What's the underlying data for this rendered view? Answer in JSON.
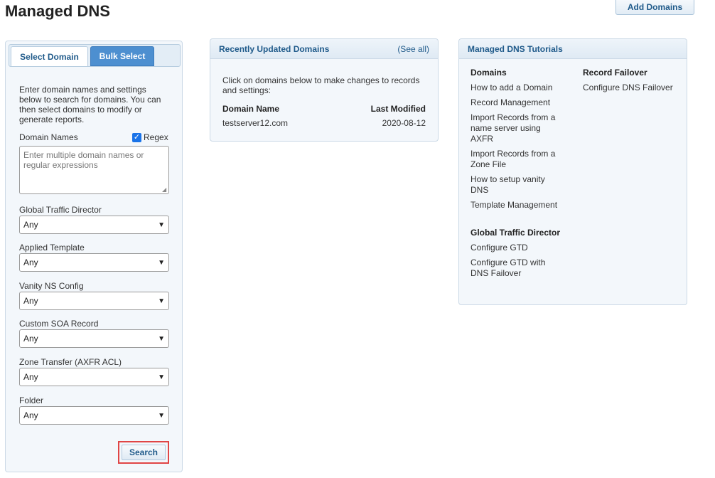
{
  "header": {
    "title": "Managed DNS",
    "add_domains_label": "Add Domains"
  },
  "left": {
    "tabs": [
      {
        "label": "Select Domain",
        "active": false
      },
      {
        "label": "Bulk Select",
        "active": true
      }
    ],
    "intro": "Enter domain names and settings below to search for domains. You can then select domains to modify or generate reports.",
    "domain_names_label": "Domain Names",
    "regex_label": "Regex",
    "regex_checked": true,
    "domain_names_placeholder": "Enter multiple domain names or regular expressions",
    "filters": [
      {
        "label": "Global Traffic Director",
        "value": "Any"
      },
      {
        "label": "Applied Template",
        "value": "Any"
      },
      {
        "label": "Vanity NS Config",
        "value": "Any"
      },
      {
        "label": "Custom SOA Record",
        "value": "Any"
      },
      {
        "label": "Zone Transfer (AXFR ACL)",
        "value": "Any"
      },
      {
        "label": "Folder",
        "value": "Any"
      }
    ],
    "search_label": "Search"
  },
  "recent": {
    "title": "Recently Updated Domains",
    "see_all": "(See all)",
    "description": "Click on domains below to make changes to records and settings:",
    "columns": [
      "Domain Name",
      "Last Modified"
    ],
    "rows": [
      {
        "domain": "testserver12.com",
        "modified": "2020-08-12"
      }
    ]
  },
  "tutorials": {
    "title": "Managed DNS Tutorials",
    "domains_heading": "Domains",
    "domains_links": [
      "How to add a Domain",
      "Record Management",
      "Import Records from a name server using AXFR",
      "Import Records from a Zone File",
      "How to setup vanity DNS",
      "Template Management"
    ],
    "gtd_heading": "Global Traffic Director",
    "gtd_links": [
      "Configure GTD",
      "Configure GTD with DNS Failover"
    ],
    "failover_heading": "Record Failover",
    "failover_links": [
      "Configure DNS Failover"
    ]
  }
}
